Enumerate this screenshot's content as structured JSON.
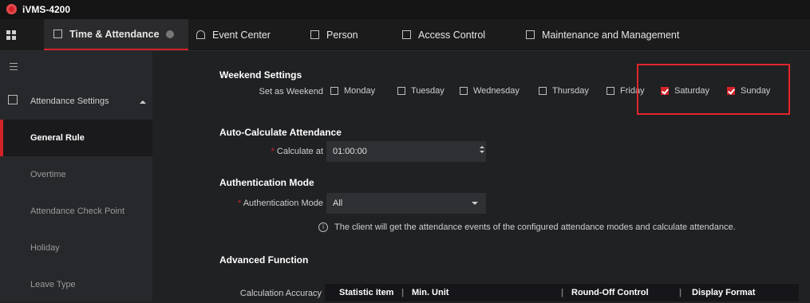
{
  "app": {
    "title": "iVMS-4200",
    "brand_color": "#d22328"
  },
  "tabs": [
    {
      "label": "Time & Attendance",
      "icon": "calendar-icon",
      "active": true
    },
    {
      "label": "Event Center",
      "icon": "alarm-icon"
    },
    {
      "label": "Person",
      "icon": "person-icon"
    },
    {
      "label": "Access Control",
      "icon": "door-icon"
    },
    {
      "label": "Maintenance and Management",
      "icon": "maintenance-icon"
    }
  ],
  "sidebar": {
    "group": "Attendance Settings",
    "items": [
      "General Rule",
      "Overtime",
      "Attendance Check Point",
      "Holiday",
      "Leave Type"
    ],
    "active": "General Rule"
  },
  "weekend": {
    "title": "Weekend Settings",
    "label": "Set as Weekend",
    "days": [
      {
        "label": "Monday",
        "checked": false
      },
      {
        "label": "Tuesday",
        "checked": false
      },
      {
        "label": "Wednesday",
        "checked": false
      },
      {
        "label": "Thursday",
        "checked": false
      },
      {
        "label": "Friday",
        "checked": false
      },
      {
        "label": "Saturday",
        "checked": true
      },
      {
        "label": "Sunday",
        "checked": true
      }
    ]
  },
  "auto_calc": {
    "title": "Auto-Calculate Attendance",
    "label": "Calculate at",
    "value": "01:00:00"
  },
  "auth": {
    "title": "Authentication Mode",
    "label": "Authentication Mode",
    "value": "All",
    "info": "The client will get the attendance events of the configured attendance modes and calculate attendance."
  },
  "advanced": {
    "title": "Advanced Function",
    "label": "Calculation Accuracy",
    "columns": [
      "Statistic Item",
      "Min. Unit",
      "Round-Off Control",
      "Display Format"
    ]
  }
}
